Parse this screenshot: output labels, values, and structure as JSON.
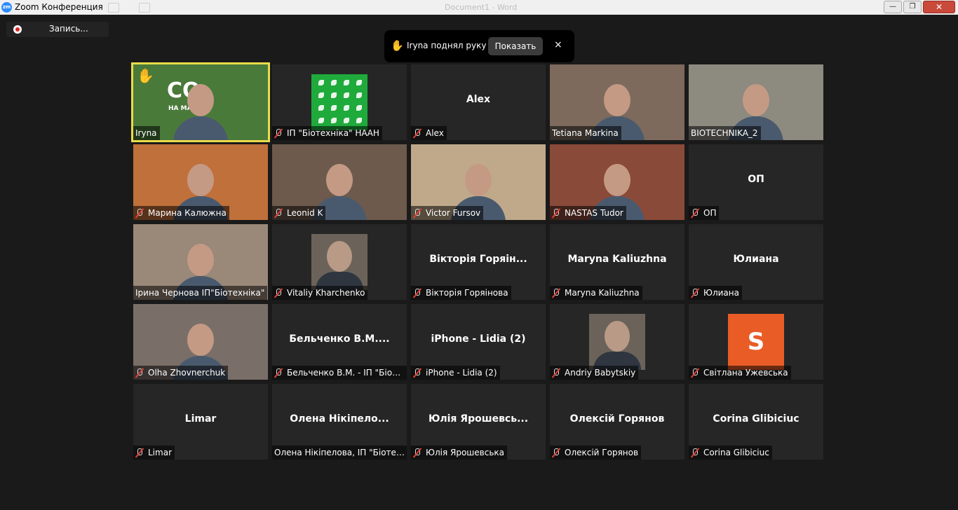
{
  "window": {
    "title": "Zoom Конференция",
    "logo": "zm",
    "ghost_title": "Document1 - Word",
    "buttons": {
      "minimize": "—",
      "maximize": "❐",
      "close": "✕"
    }
  },
  "recording": {
    "label": "Запись..."
  },
  "notification": {
    "text": "Iryna поднял руку",
    "show_button": "Показать",
    "close": "×"
  },
  "tiles": [
    {
      "name": "Iryna",
      "muted": false,
      "video": true,
      "active": true,
      "hand_raised": true,
      "bg": "#4a7a3a",
      "logo_text": "СО",
      "logo_sub": "НА МАЙ"
    },
    {
      "name": "ІП \"Біотехніка\" НААН",
      "muted": true,
      "video": false,
      "avatar": "leaf-logo"
    },
    {
      "name": "Alex",
      "muted": true,
      "video": false,
      "center": "Alex"
    },
    {
      "name": "Tetiana Markina",
      "muted": false,
      "video": true,
      "bg": "#7d6a5d"
    },
    {
      "name": "BIOTECHNIKA_2",
      "muted": false,
      "video": true,
      "bg": "#8d8a80"
    },
    {
      "name": "Марина Калюжна",
      "muted": true,
      "video": true,
      "bg": "#c0703a"
    },
    {
      "name": "Leonid K",
      "muted": true,
      "video": true,
      "bg": "#6d5a4d"
    },
    {
      "name": "Victor Fursov",
      "muted": true,
      "video": true,
      "bg": "#bfa98a"
    },
    {
      "name": "NASTAS Tudor",
      "muted": true,
      "video": true,
      "bg": "#8a4a3a"
    },
    {
      "name": "ОП",
      "muted": true,
      "video": false,
      "center": "ОП"
    },
    {
      "name": "Ірина Чернова ІП\"Біотехніка\"",
      "muted": false,
      "video": true,
      "bg": "#9a8878"
    },
    {
      "name": "Vitaliy Kharchenko",
      "muted": true,
      "video": false,
      "avatar": "photo"
    },
    {
      "name": "Вікторія Горяінова",
      "muted": true,
      "video": false,
      "center": "Вікторія Горяін..."
    },
    {
      "name": "Maryna Kaliuzhna",
      "muted": true,
      "video": false,
      "center": "Maryna Kaliuzhna"
    },
    {
      "name": "Юлиана",
      "muted": true,
      "video": false,
      "center": "Юлиана"
    },
    {
      "name": "Olha Zhovnerchuk",
      "muted": true,
      "video": true,
      "bg": "#7a6e68"
    },
    {
      "name": "Бельченко В.М. - ІП \"Біоте...",
      "muted": true,
      "video": false,
      "center": "Бельченко  В.М...."
    },
    {
      "name": "iPhone - Lidia (2)",
      "muted": true,
      "video": false,
      "center": "iPhone - Lidia (2)"
    },
    {
      "name": "Andriy Babytskiy",
      "muted": true,
      "video": false,
      "avatar": "photo"
    },
    {
      "name": "Світлана Ужевська",
      "muted": true,
      "video": false,
      "avatar": "letter",
      "letter": "S"
    },
    {
      "name": "Limar",
      "muted": true,
      "video": false,
      "center": "Limar"
    },
    {
      "name": "Олена Нікіпелова, ІП \"Біотех...",
      "muted": false,
      "video": false,
      "center": "Олена  Нікіпело..."
    },
    {
      "name": "Юлія Ярошевська",
      "muted": true,
      "video": false,
      "center": "Юлія  Ярошевсь..."
    },
    {
      "name": "Олексій Горянов",
      "muted": true,
      "video": false,
      "center": "Олексій Горянов"
    },
    {
      "name": "Corina Glibiciuc",
      "muted": true,
      "video": false,
      "center": "Corina Glibiciuc"
    }
  ]
}
